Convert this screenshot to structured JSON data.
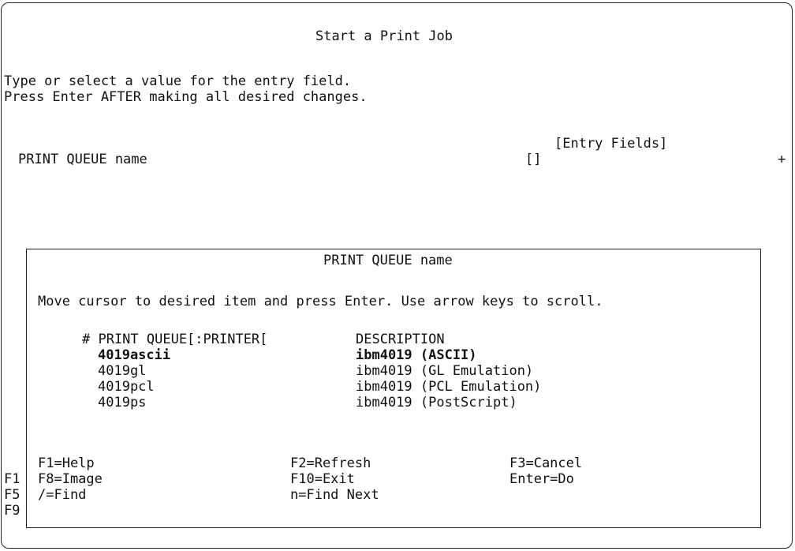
{
  "screen": {
    "title": "Start a Print Job",
    "instructions": [
      "Type or select a value for the entry field.",
      "Press Enter AFTER making all desired changes."
    ],
    "entry_fields_header": "[Entry Fields]",
    "field": {
      "label": "PRINT QUEUE name",
      "value": "[]",
      "list_indicator": "+"
    },
    "bg_keys": [
      "F1",
      "F5",
      "F9"
    ]
  },
  "popup": {
    "title": "PRINT QUEUE name",
    "instruction": "Move cursor to desired item and press Enter. Use arrow keys to scroll.",
    "header": {
      "col1": "# PRINT QUEUE[:PRINTER[",
      "col2": "DESCRIPTION"
    },
    "items": [
      {
        "queue": "4019ascii",
        "description": "ibm4019 (ASCII)",
        "selected": true
      },
      {
        "queue": "4019gl",
        "description": "ibm4019 (GL Emulation)",
        "selected": false
      },
      {
        "queue": "4019pcl",
        "description": "ibm4019 (PCL Emulation)",
        "selected": false
      },
      {
        "queue": "4019ps",
        "description": "ibm4019 (PostScript)",
        "selected": false
      }
    ],
    "function_keys": [
      [
        "F1=Help",
        "F2=Refresh",
        "F3=Cancel"
      ],
      [
        "F8=Image",
        "F10=Exit",
        "Enter=Do"
      ],
      [
        "/=Find",
        "n=Find Next"
      ]
    ]
  }
}
